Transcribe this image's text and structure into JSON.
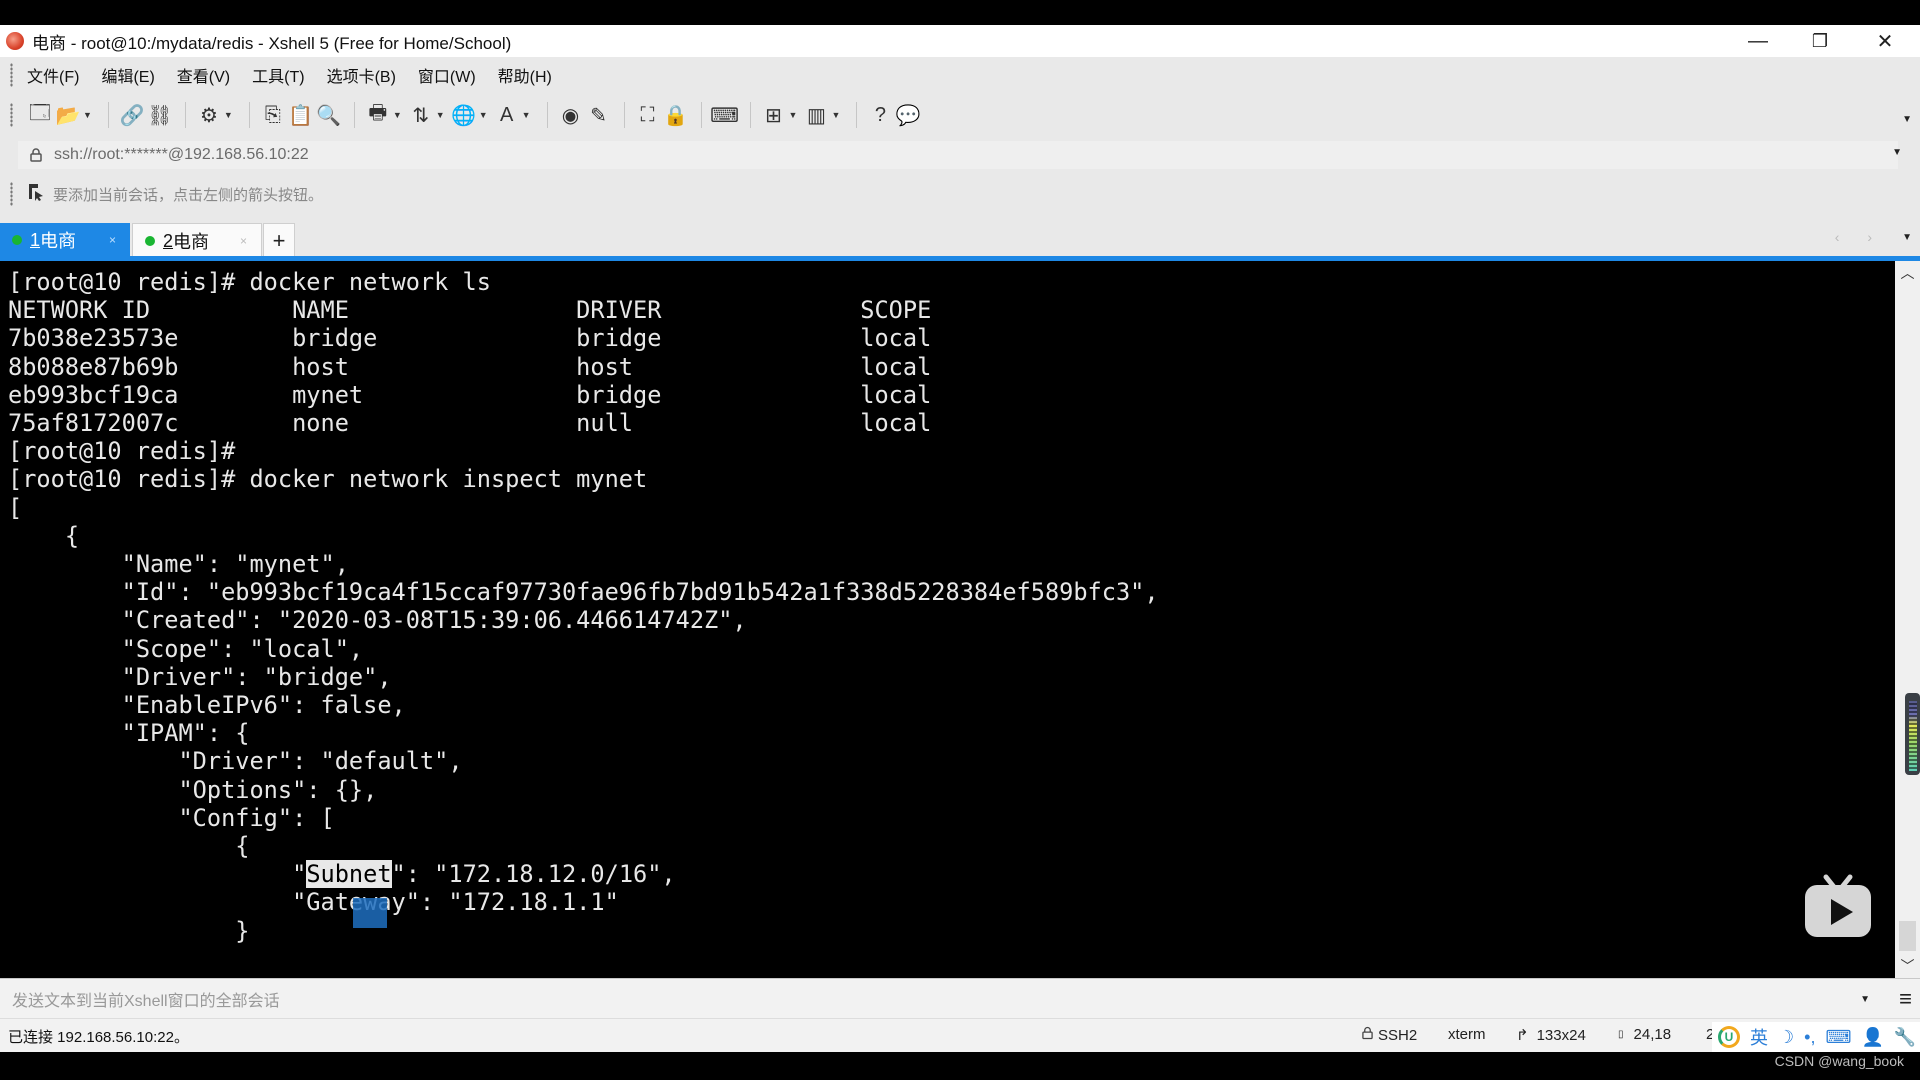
{
  "window": {
    "title": "电商 - root@10:/mydata/redis - Xshell 5 (Free for Home/School)",
    "controls": {
      "minimize": "—",
      "restore": "❐",
      "close": "✕"
    }
  },
  "menu": [
    "文件(F)",
    "编辑(E)",
    "查看(V)",
    "工具(T)",
    "选项卡(B)",
    "窗口(W)",
    "帮助(H)"
  ],
  "toolbar": {
    "icons": [
      {
        "name": "new-session-icon",
        "glyph": "🗔",
        "dropdown": false
      },
      {
        "name": "open-folder-icon",
        "glyph": "📂",
        "dropdown": true
      },
      {
        "sep": true
      },
      {
        "name": "connect-icon",
        "glyph": "🔗",
        "dropdown": false
      },
      {
        "name": "disconnect-icon",
        "glyph": "⛓",
        "dropdown": false
      },
      {
        "sep": true
      },
      {
        "name": "properties-icon",
        "glyph": "⚙",
        "dropdown": true
      },
      {
        "sep": true
      },
      {
        "name": "copy-icon",
        "glyph": "⎘",
        "dropdown": false
      },
      {
        "name": "paste-icon",
        "glyph": "📋",
        "dropdown": false
      },
      {
        "name": "find-icon",
        "glyph": "🔍",
        "dropdown": false
      },
      {
        "sep": true
      },
      {
        "name": "print-icon",
        "glyph": "🖶",
        "dropdown": true
      },
      {
        "name": "transfer-icon",
        "glyph": "⇅",
        "dropdown": true
      },
      {
        "name": "globe-icon",
        "glyph": "🌐",
        "dropdown": true
      },
      {
        "name": "font-icon",
        "glyph": "A",
        "dropdown": true
      },
      {
        "sep": true
      },
      {
        "name": "xftp-icon",
        "glyph": "◉",
        "dropdown": false
      },
      {
        "name": "script-icon",
        "glyph": "✎",
        "dropdown": false
      },
      {
        "sep": true
      },
      {
        "name": "fullscreen-icon",
        "glyph": "⛶",
        "dropdown": false
      },
      {
        "name": "lock-icon",
        "glyph": "🔒",
        "dropdown": false
      },
      {
        "sep": true
      },
      {
        "name": "keyboard-icon",
        "glyph": "⌨",
        "dropdown": false
      },
      {
        "sep": true
      },
      {
        "name": "new-tab-icon",
        "glyph": "⊞",
        "dropdown": true
      },
      {
        "name": "layout-icon",
        "glyph": "▥",
        "dropdown": true
      },
      {
        "sep": true
      },
      {
        "name": "help-icon",
        "glyph": "?",
        "dropdown": false
      },
      {
        "name": "chat-icon",
        "glyph": "💬",
        "dropdown": false
      }
    ]
  },
  "address": {
    "value": "ssh://root:*******@192.168.56.10:22"
  },
  "hint": "要添加当前会话，点击左侧的箭头按钮。",
  "tabs": [
    {
      "index": "1",
      "label": "电商",
      "active": true,
      "close": "×"
    },
    {
      "index": "2",
      "label": "电商",
      "active": false,
      "close": "×"
    }
  ],
  "tab_add": "+",
  "tab_nav": "‹ ›",
  "terminal": {
    "lines": [
      "[root@10 redis]# docker network ls",
      "NETWORK ID          NAME                DRIVER              SCOPE",
      "7b038e23573e        bridge              bridge              local",
      "8b088e87b69b        host                host                local",
      "eb993bcf19ca        mynet               bridge              local",
      "75af8172007c        none                null                local",
      "[root@10 redis]#",
      "[root@10 redis]# docker network inspect mynet",
      "[",
      "    {",
      "        \"Name\": \"mynet\",",
      "        \"Id\": \"eb993bcf19ca4f15ccaf97730fae96fb7bd91b542a1f338d5228384ef589bfc3\",",
      "        \"Created\": \"2020-03-08T15:39:06.446614742Z\",",
      "        \"Scope\": \"local\",",
      "        \"Driver\": \"bridge\",",
      "        \"EnableIPv6\": false,",
      "        \"IPAM\": {",
      "            \"Driver\": \"default\",",
      "            \"Options\": {},",
      "            \"Config\": [",
      "                {"
    ],
    "subnet_line": {
      "prefix": "                    \"",
      "highlight": "Subnet",
      "suffix": "\": \"172.18.12.0/16\","
    },
    "gateway_line": "                    \"Gateway\": \"172.18.1.1\"",
    "closing_line": "                }"
  },
  "input_bar": {
    "placeholder": "发送文本到当前Xshell窗口的全部会话"
  },
  "status": {
    "connection": "已连接 192.168.56.10:22。",
    "protocol": "SSH2",
    "terminal_type": "xterm",
    "size": "133x24",
    "cursor_pos": "24,18",
    "extra": "2"
  },
  "ime": {
    "mode": "英"
  },
  "watermark": "CSDN @wang_book"
}
